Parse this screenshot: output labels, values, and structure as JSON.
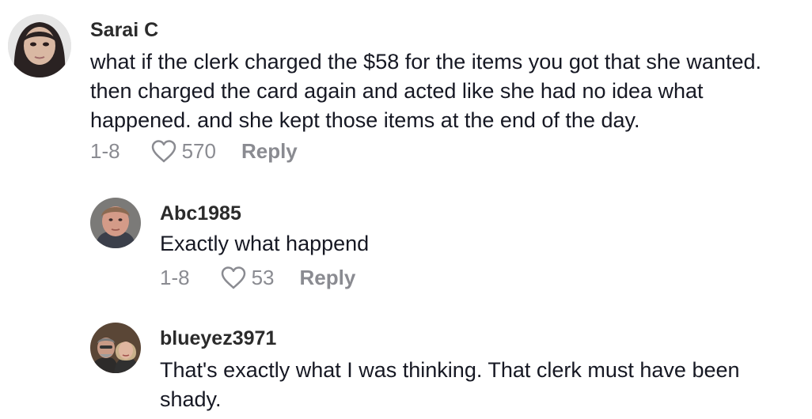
{
  "comments": [
    {
      "username": "Sarai C",
      "text": "what if the clerk charged the $58 for the items you got that she wanted. then charged the card again and acted like she had no idea what happened. and she kept those items at the end of the day.",
      "date": "1-8",
      "likes": "570",
      "reply_label": "Reply",
      "avatar_icon": "user-avatar"
    },
    {
      "username": "Abc1985",
      "text": "Exactly what happend",
      "date": "1-8",
      "likes": "53",
      "reply_label": "Reply",
      "avatar_icon": "user-avatar"
    },
    {
      "username": "blueyez3971",
      "text": "That's exactly what I was thinking. That clerk must have been shady.",
      "avatar_icon": "user-avatar"
    }
  ],
  "colors": {
    "username": "#2b2b2b",
    "text": "#161823",
    "meta": "#8a8b91"
  }
}
